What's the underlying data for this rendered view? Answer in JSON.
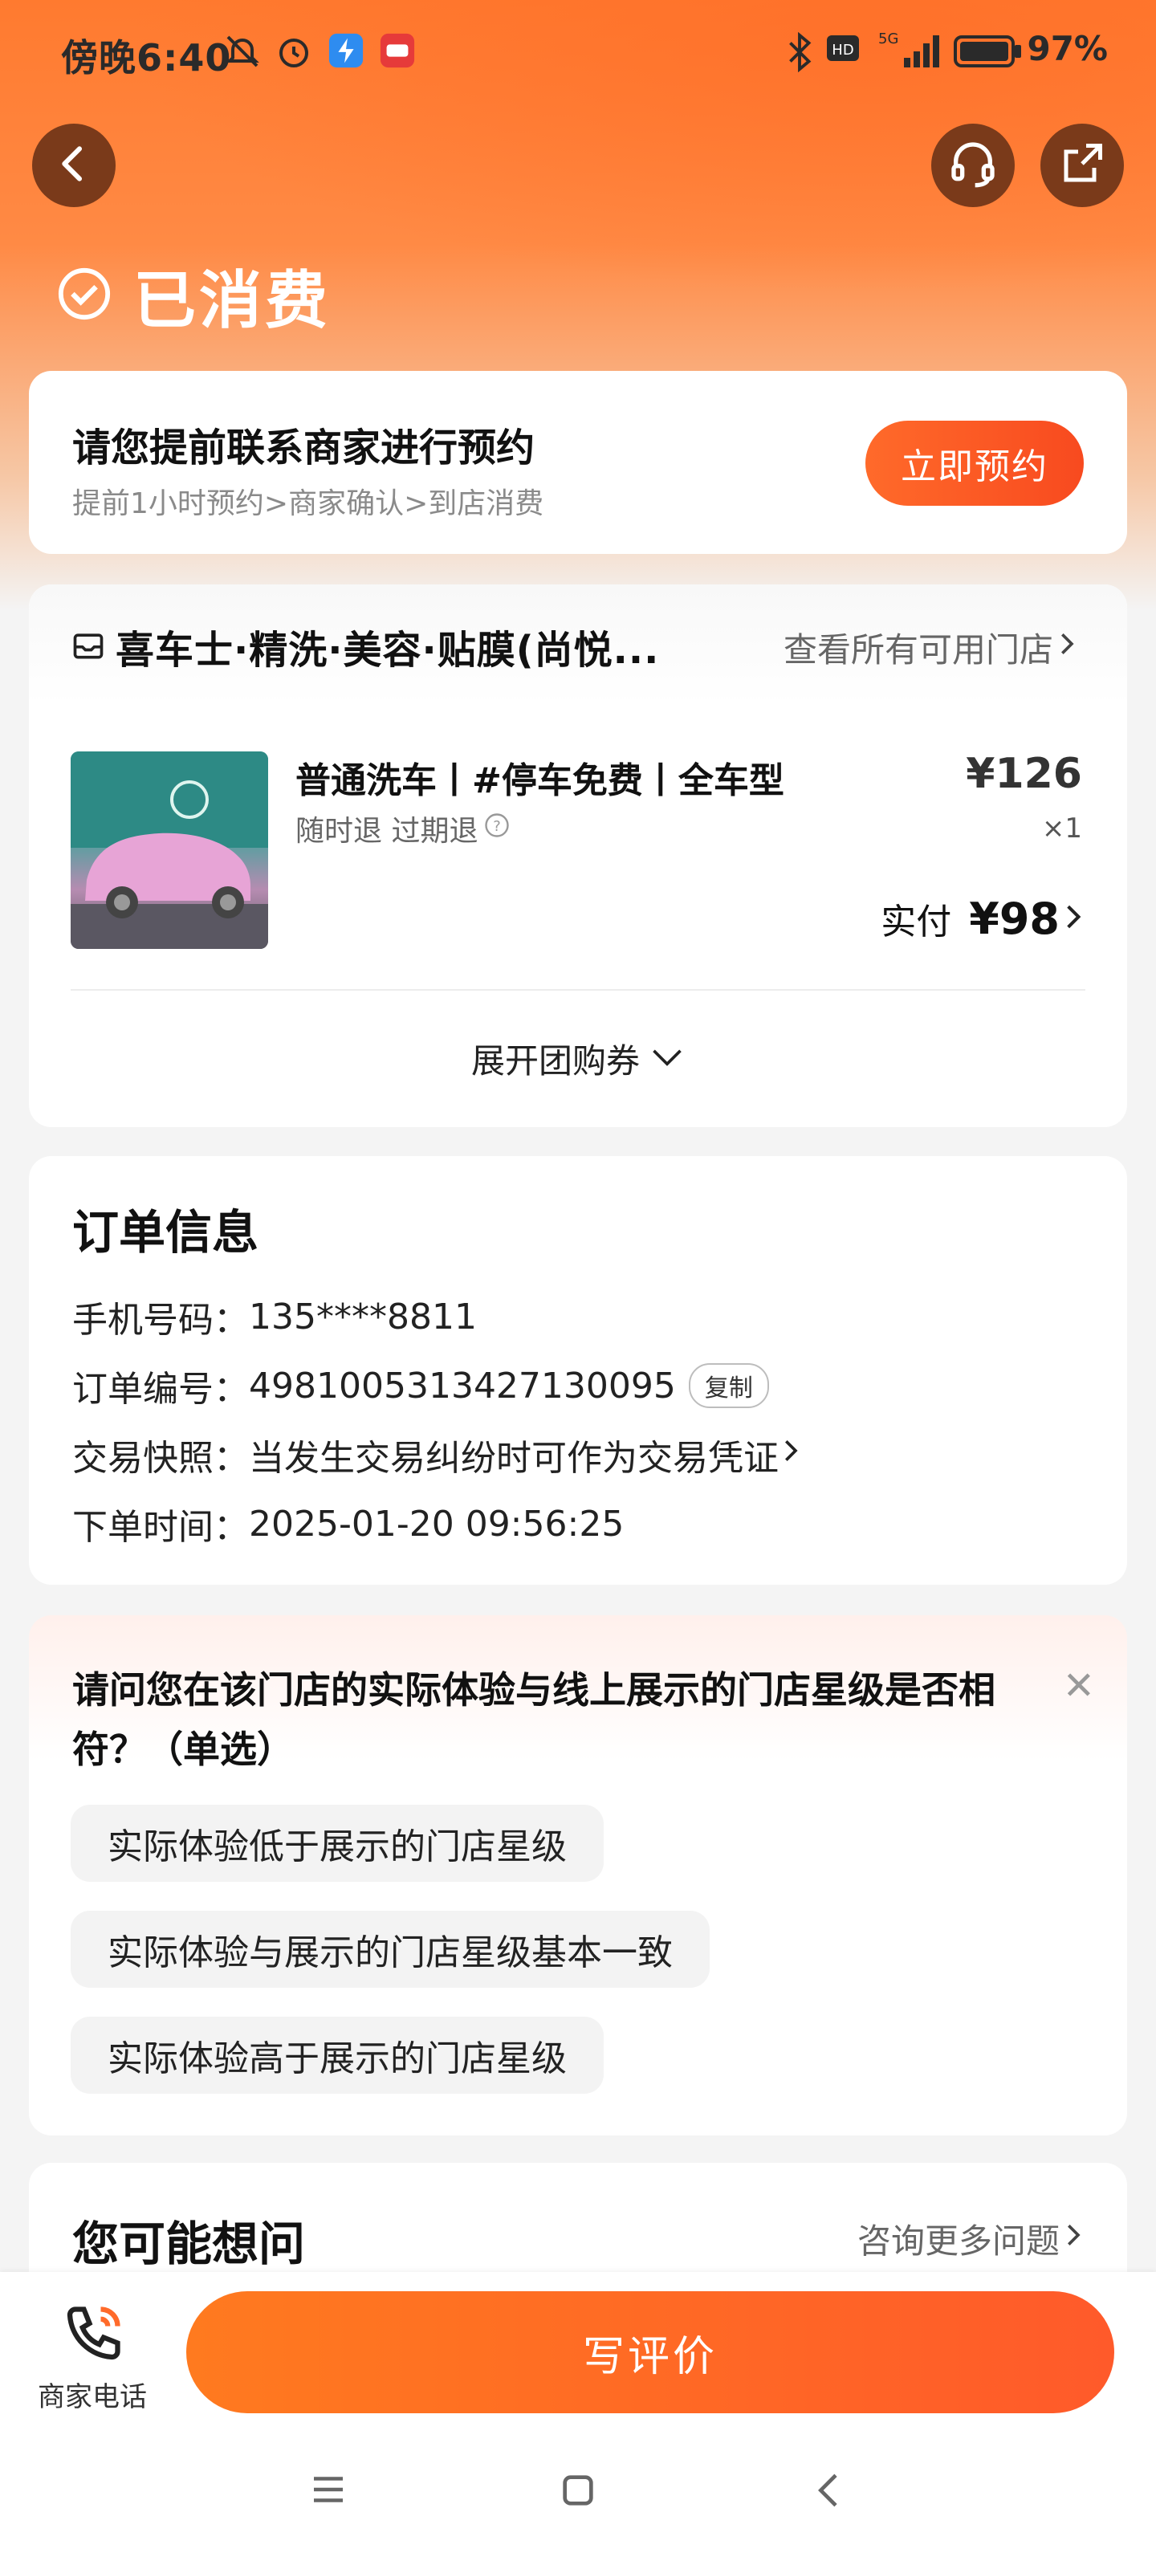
{
  "status_bar": {
    "time": "傍晚6:40",
    "network": "5G",
    "battery": "97%"
  },
  "header": {
    "status": "已消费"
  },
  "appointment": {
    "title": "请您提前联系商家进行预约",
    "subtitle": "提前1小时预约>商家确认>到店消费",
    "button": "立即预约"
  },
  "store": {
    "name": "喜车士·精洗·美容·贴膜(尚悦...",
    "all_stores_link": "查看所有可用门店"
  },
  "product": {
    "name": "普通洗车丨#停车免费丨全车型",
    "tags": "随时退 过期退",
    "price": "¥126",
    "quantity": "×1",
    "paid_label": "实付",
    "paid_amount": "¥98",
    "expand": "展开团购券"
  },
  "order": {
    "title": "订单信息",
    "phone_label": "手机号码：",
    "phone": "135****8811",
    "order_no_label": "订单编号：",
    "order_no": "4981005313427130095",
    "copy": "复制",
    "snapshot_label": "交易快照：",
    "snapshot": "当发生交易纠纷时可作为交易凭证",
    "time_label": "下单时间：",
    "time": "2025-01-20 09:56:25"
  },
  "survey": {
    "question": "请问您在该门店的实际体验与线上展示的门店星级是否相符？（单选）",
    "options": [
      "实际体验低于展示的门店星级",
      "实际体验与展示的门店星级基本一致",
      "实际体验高于展示的门店星级"
    ]
  },
  "faq": {
    "title": "您可能想问",
    "link": "咨询更多问题"
  },
  "bottom": {
    "phone_label": "商家电话",
    "review_button": "写评价"
  },
  "colors": {
    "accent": "#ff6a2a",
    "header": "#ff7a2f"
  }
}
